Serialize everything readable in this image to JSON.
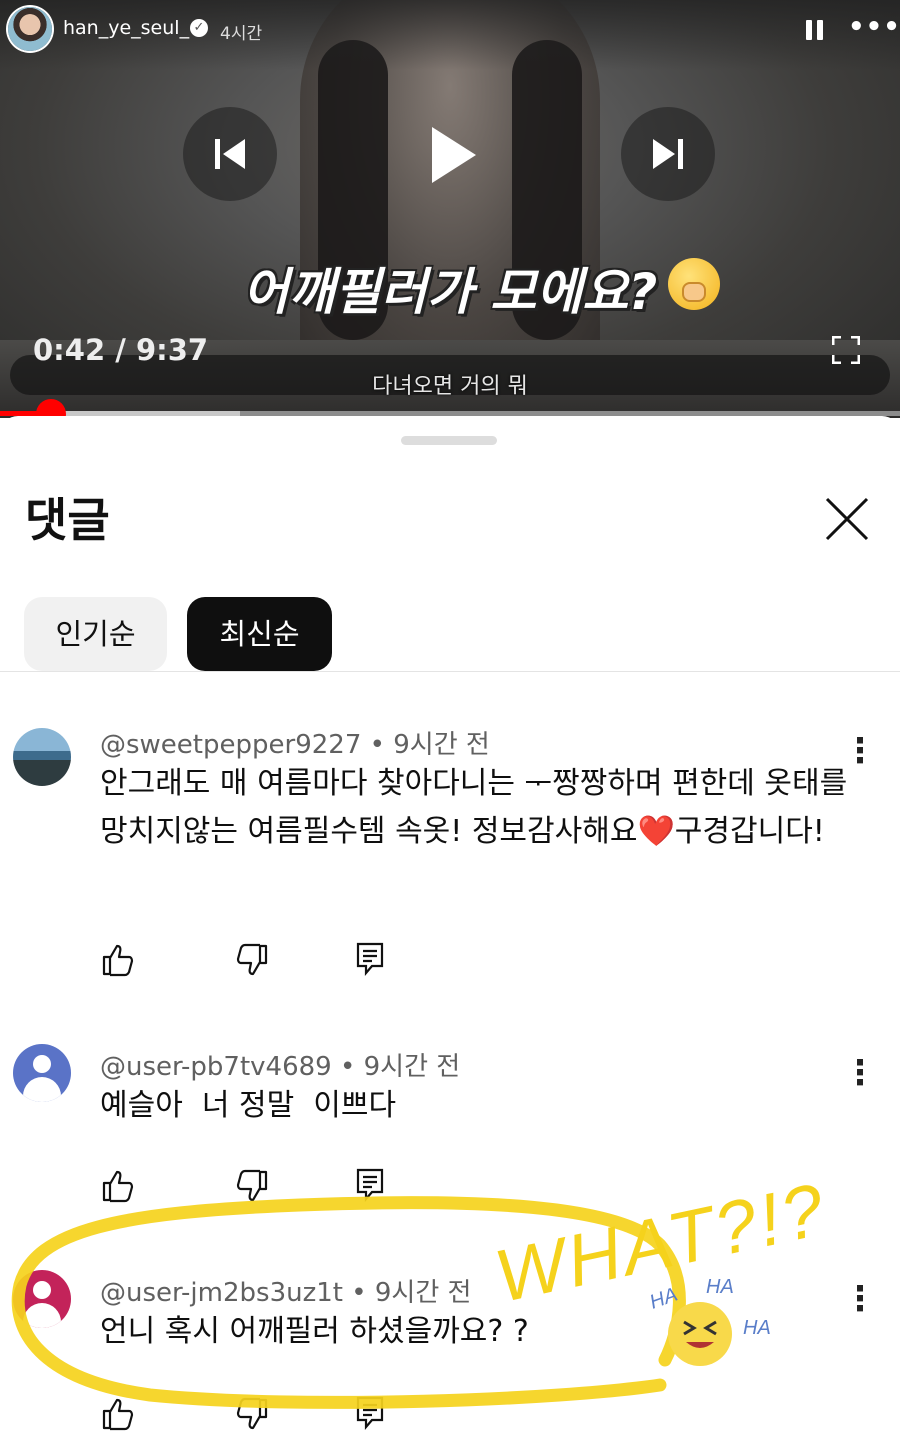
{
  "story": {
    "username": "han_ye_seul_",
    "time": "4시간"
  },
  "video": {
    "caption": "어깨필러가 모에요?",
    "current_time": "0:42",
    "separator": " / ",
    "duration": "9:37",
    "subtitle": "다녀오면 거의 뭐",
    "progress_fraction": 0.057,
    "accent": "#ff0000"
  },
  "comments_panel": {
    "title": "댓글",
    "chips": {
      "popular": "인기순",
      "newest": "최신순",
      "selected": "newest"
    }
  },
  "comments": [
    {
      "author": "@sweetpepper9227",
      "time": "9시간 전",
      "text_before_heart": "안그래도 매 여름마다 찾아다니는 ᅮ짱짱하며 편한데 옷태를 망치지않는 여름필수템 속옷! 정보감사해요",
      "heart": "❤️",
      "text_after_heart": "구경갑니다!"
    },
    {
      "author": "@user-pb7tv4689",
      "time": "9시간 전",
      "text": "예슬아  너 정말  이쁘다"
    },
    {
      "author": "@user-jm2bs3uz1t",
      "time": "9시간 전",
      "text": "언니 혹시 어깨필러 하셨을까요? ?"
    }
  ],
  "annotation": {
    "text": "WHAT?!?",
    "laugh": [
      "HA",
      "HA",
      "HA"
    ],
    "color": "#f5d21c"
  }
}
